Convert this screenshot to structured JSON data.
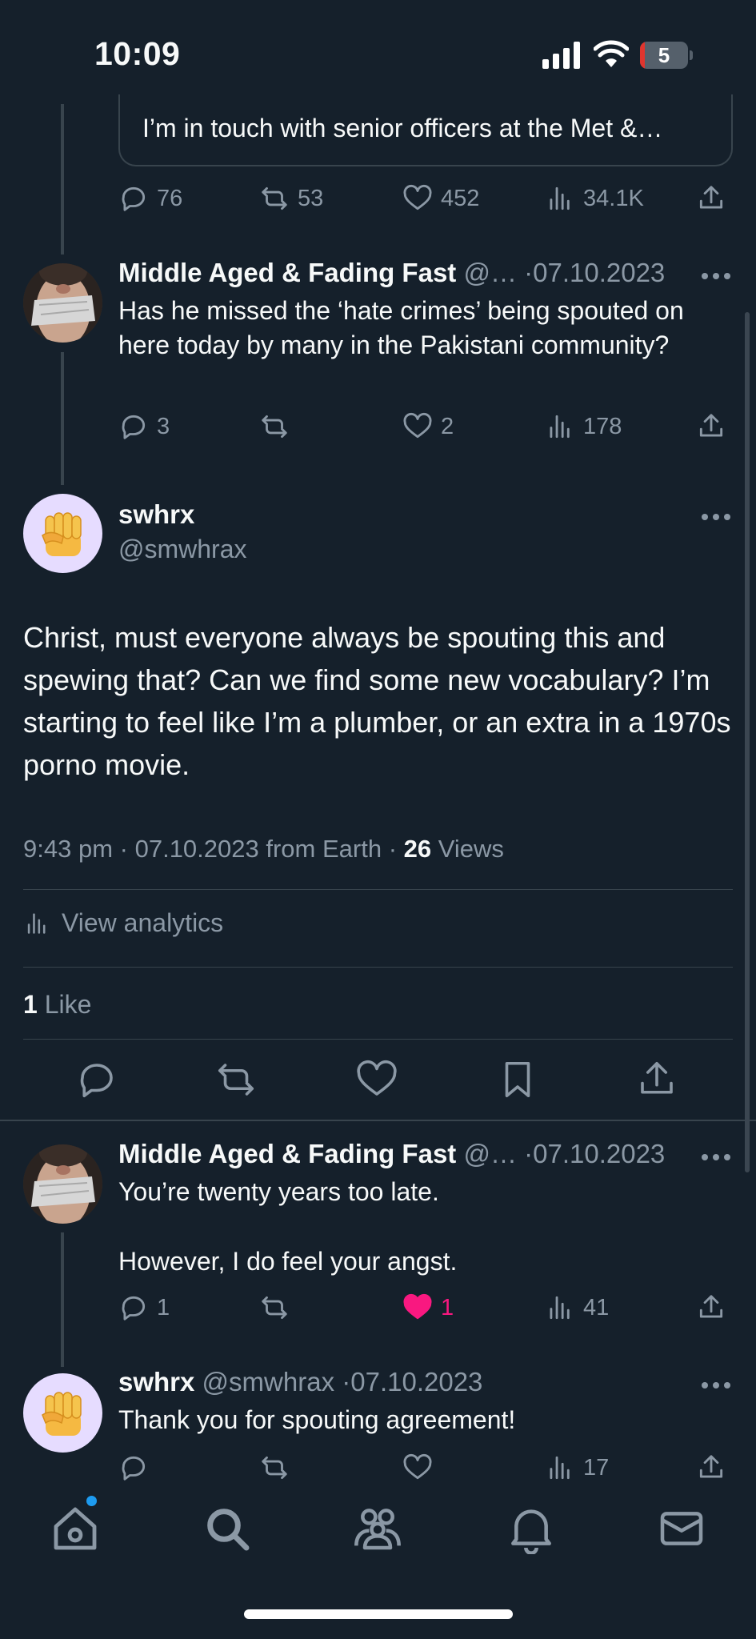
{
  "status_bar": {
    "time": "10:09",
    "battery_level": "5",
    "battery_fraction": 0.05
  },
  "quoted_tweet": {
    "text": "I’m in touch with senior officers at the Met &…"
  },
  "quoted_tweet_stats": {
    "replies": "76",
    "reposts": "53",
    "likes": "452",
    "views": "34.1K"
  },
  "reply_1": {
    "name": "Middle Aged & Fading Fast",
    "handle": "@…",
    "date": "07.10.2023",
    "text": "Has he missed the ‘hate crimes’ being spouted on here today by many in the Pakistani community?",
    "replies": "3",
    "reposts": "",
    "likes": "2",
    "views": "178"
  },
  "main_tweet": {
    "name": "swhrx",
    "handle": "@smwhrax",
    "text": "Christ, must everyone always be spouting this and spewing that? Can we find some new vocabulary? I’m starting to feel like I’m a plumber, or an extra in a 1970s porno movie.",
    "time": "9:43 pm",
    "date": "07.10.2023",
    "source": "from Earth",
    "views_count": "26",
    "views_label": "Views",
    "analytics_label": "View analytics",
    "likes_count": "1",
    "likes_label": "Like"
  },
  "reply_2": {
    "name": "Middle Aged & Fading Fast",
    "handle": "@…",
    "date": "07.10.2023",
    "text_line1": "You’re twenty years too late.",
    "text_line2": "However, I do feel your angst.",
    "replies": "1",
    "reposts": "",
    "likes": "1",
    "views": "41",
    "liked": true
  },
  "reply_3": {
    "name": "swhrx",
    "handle": "@smwhrax",
    "date": "07.10.2023",
    "text": "Thank you for spouting agreement!",
    "replies": "",
    "reposts": "",
    "likes": "",
    "views": "17"
  },
  "separator": "·",
  "tab_bar": {
    "tabs": [
      "home",
      "search",
      "communities",
      "notifications",
      "messages"
    ]
  },
  "colors": {
    "background": "#15202b",
    "like": "#f91880",
    "accent": "#1d9bf0",
    "muted": "#8b98a5",
    "divider": "#38444d"
  }
}
